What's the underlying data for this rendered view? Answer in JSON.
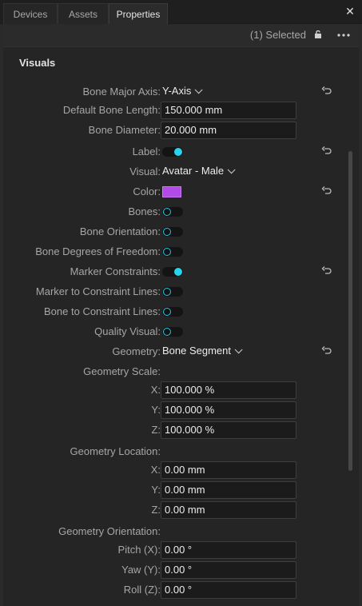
{
  "tabs": [
    {
      "label": "Devices"
    },
    {
      "label": "Assets"
    },
    {
      "label": "Properties"
    }
  ],
  "toolbar": {
    "selected_text": "(1) Selected"
  },
  "section": {
    "title": "Visuals"
  },
  "colors": {
    "accent": "#26d4ec",
    "bone_color": "#b24ae8"
  },
  "rows": {
    "bone_major_axis": {
      "label": "Bone Major Axis:",
      "value": "Y-Axis"
    },
    "default_bone_length": {
      "label": "Default Bone Length:",
      "value": "150.000 mm"
    },
    "bone_diameter": {
      "label": "Bone Diameter:",
      "value": "20.000 mm"
    },
    "label": {
      "label": "Label:",
      "on": true
    },
    "visual": {
      "label": "Visual:",
      "value": "Avatar - Male"
    },
    "color": {
      "label": "Color:"
    },
    "bones": {
      "label": "Bones:",
      "on": false
    },
    "bone_orientation": {
      "label": "Bone Orientation:",
      "on": false
    },
    "bone_dof": {
      "label": "Bone Degrees of Freedom:",
      "on": false
    },
    "marker_constraints": {
      "label": "Marker Constraints:",
      "on": true
    },
    "marker_to_constraint": {
      "label": "Marker to Constraint Lines:",
      "on": false
    },
    "bone_to_constraint": {
      "label": "Bone to Constraint Lines:",
      "on": false
    },
    "quality_visual": {
      "label": "Quality Visual:",
      "on": false
    },
    "geometry": {
      "label": "Geometry:",
      "value": "Bone Segment"
    },
    "geometry_scale": {
      "label": "Geometry Scale:"
    },
    "scale_x": {
      "label": "X:",
      "value": "100.000 %"
    },
    "scale_y": {
      "label": "Y:",
      "value": "100.000 %"
    },
    "scale_z": {
      "label": "Z:",
      "value": "100.000 %"
    },
    "geometry_location": {
      "label": "Geometry Location:"
    },
    "loc_x": {
      "label": "X:",
      "value": "0.00 mm"
    },
    "loc_y": {
      "label": "Y:",
      "value": "0.00 mm"
    },
    "loc_z": {
      "label": "Z:",
      "value": "0.00 mm"
    },
    "geometry_orientation": {
      "label": "Geometry Orientation:"
    },
    "pitch": {
      "label": "Pitch (X):",
      "value": "0.00 °"
    },
    "yaw": {
      "label": "Yaw (Y):",
      "value": "0.00 °"
    },
    "roll": {
      "label": "Roll (Z):",
      "value": "0.00 °"
    }
  }
}
